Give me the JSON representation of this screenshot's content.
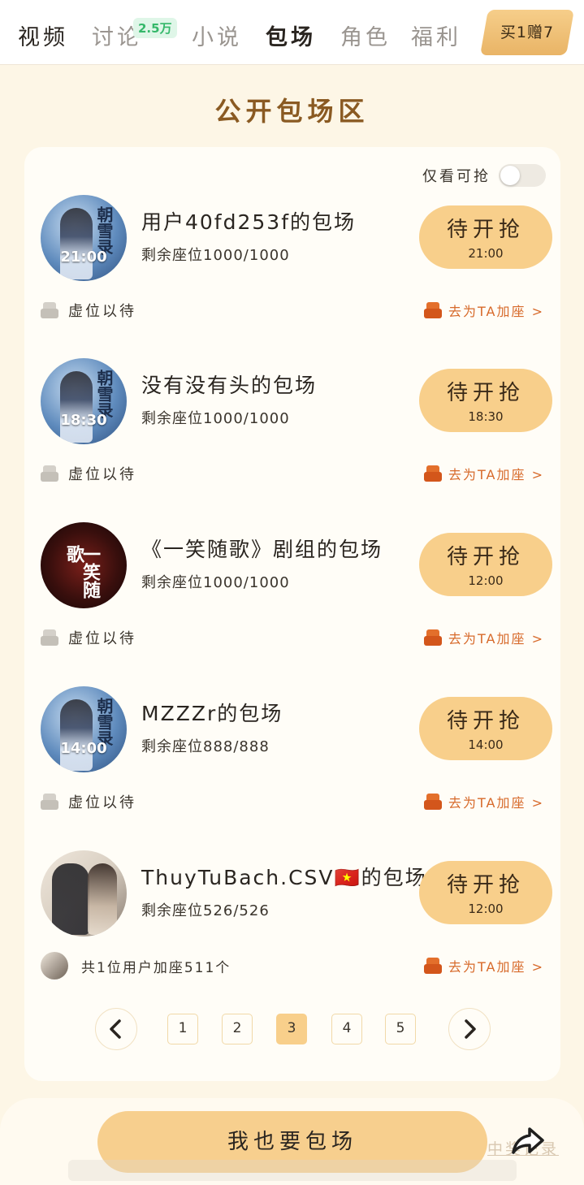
{
  "tabs": [
    {
      "label": "视频",
      "active": false
    },
    {
      "label": "讨论",
      "badge": "2.5万",
      "active": false
    },
    {
      "label": "小说",
      "active": false
    },
    {
      "label": "包场",
      "active": true
    },
    {
      "label": "角色",
      "active": false
    },
    {
      "label": "福利",
      "active": false
    }
  ],
  "promo": {
    "label": "买1赠7"
  },
  "section_title": "公开包场区",
  "filter": {
    "label": "仅看可抢",
    "enabled": false
  },
  "rows": [
    {
      "title": "用户40fd253f的包场",
      "seats": "剩余座位1000/1000",
      "button_label": "待开抢",
      "button_time": "21:00",
      "avatar_time": "21:00",
      "avatar_type": "drama-poster",
      "left_text": "虚位以待",
      "join_label": "去为TA加座 >"
    },
    {
      "title": "没有没有头的包场",
      "seats": "剩余座位1000/1000",
      "button_label": "待开抢",
      "button_time": "18:30",
      "avatar_time": "18:30",
      "avatar_type": "drama-poster",
      "left_text": "虚位以待",
      "join_label": "去为TA加座 >"
    },
    {
      "title": "《一笑随歌》剧组的包场",
      "seats": "剩余座位1000/1000",
      "button_label": "待开抢",
      "button_time": "12:00",
      "avatar_type": "red-poster",
      "left_text": "虚位以待",
      "join_label": "去为TA加座 >"
    },
    {
      "title": "MZZZr的包场",
      "seats": "剩余座位888/888",
      "button_label": "待开抢",
      "button_time": "14:00",
      "avatar_time": "14:00",
      "avatar_type": "drama-poster",
      "left_text": "虚位以待",
      "join_label": "去为TA加座 >"
    },
    {
      "title": "ThuyTuBach.CSV🇻🇳的包场",
      "seats": "剩余座位526/526",
      "button_label": "待开抢",
      "button_time": "12:00",
      "avatar_type": "couple-photo",
      "left_text": "共1位用户加座511个",
      "join_label": "去为TA加座 >"
    }
  ],
  "pagination": {
    "pages": [
      "1",
      "2",
      "3",
      "4",
      "5"
    ],
    "current": "3",
    "prev_icon": "chevron-left-icon",
    "next_icon": "chevron-right-icon"
  },
  "bottom": {
    "cta_label": "我也要包场",
    "record_label": "中奖记录"
  },
  "colors": {
    "accent": "#f8cf8b",
    "title": "#8a5a22",
    "join": "#d76a2b",
    "background": "#fdf6e6"
  }
}
